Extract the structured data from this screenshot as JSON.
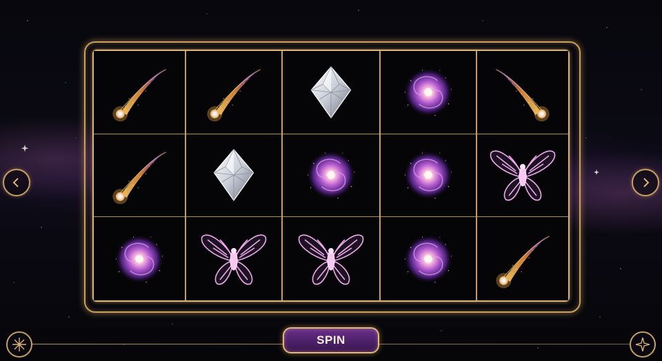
{
  "controls": {
    "spin_label": "SPIN",
    "prev_icon": "chevron-left-icon",
    "next_icon": "chevron-right-icon",
    "left_corner_icon": "sparkle-burst-icon",
    "right_corner_icon": "four-point-star-icon"
  },
  "colors": {
    "frame_gold": "#c9a063",
    "spin_purple": "#4a1f66",
    "cell_bg": "#050507"
  },
  "reels": [
    [
      "comet",
      "comet",
      "galaxy"
    ],
    [
      "comet",
      "diamond",
      "moth"
    ],
    [
      "diamond",
      "galaxy",
      "moth"
    ],
    [
      "galaxy",
      "galaxy",
      "galaxy"
    ],
    [
      "comet",
      "moth",
      "comet"
    ]
  ]
}
